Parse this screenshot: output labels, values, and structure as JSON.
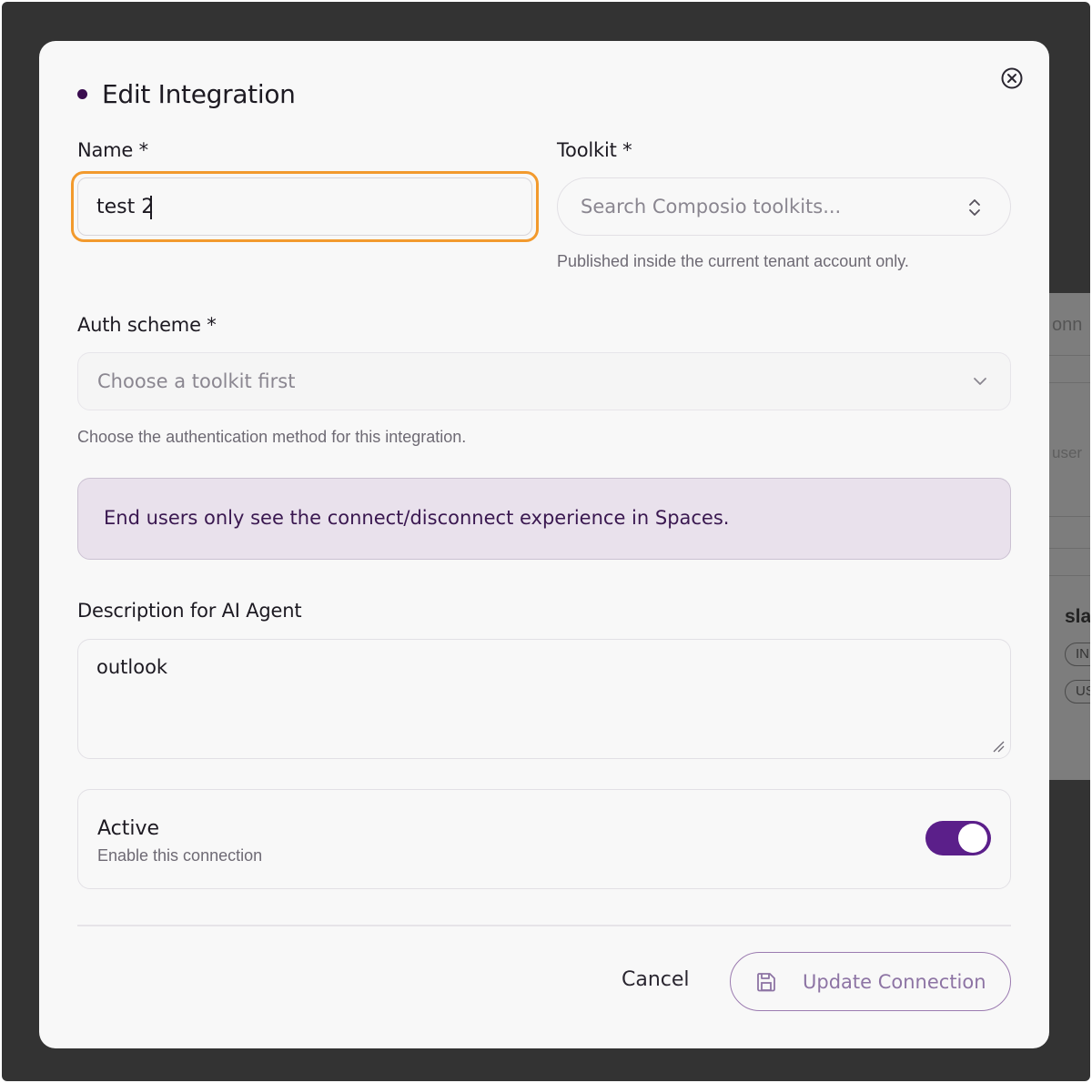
{
  "dialog": {
    "title": "Edit Integration",
    "close_icon": "close-circle-icon"
  },
  "name": {
    "label": "Name *",
    "value": "test 2"
  },
  "toolkit": {
    "label": "Toolkit *",
    "placeholder": "Search Composio toolkits...",
    "hint": "Published inside the current tenant account only.",
    "icon": "chevron-up-down-icon"
  },
  "auth_scheme": {
    "label": "Auth scheme *",
    "placeholder": "Choose a toolkit first",
    "hint": "Choose the authentication method for this integration.",
    "icon": "chevron-down-icon"
  },
  "info": {
    "text": "End users only see the connect/disconnect experience in Spaces."
  },
  "description": {
    "label": "Description for AI Agent",
    "value": "outlook"
  },
  "active": {
    "title": "Active",
    "subtitle": "Enable this connection",
    "enabled": true
  },
  "footer": {
    "cancel_label": "Cancel",
    "update_label": "Update Connection",
    "update_icon": "save-icon"
  },
  "background": {
    "fragments": [
      "onn",
      "user",
      "sla",
      "IN",
      "US"
    ]
  },
  "colors": {
    "accent": "#5b1f8a",
    "focus_ring": "#f29a2e",
    "info_bg": "#e9e1ec",
    "info_text": "#3a1850"
  }
}
